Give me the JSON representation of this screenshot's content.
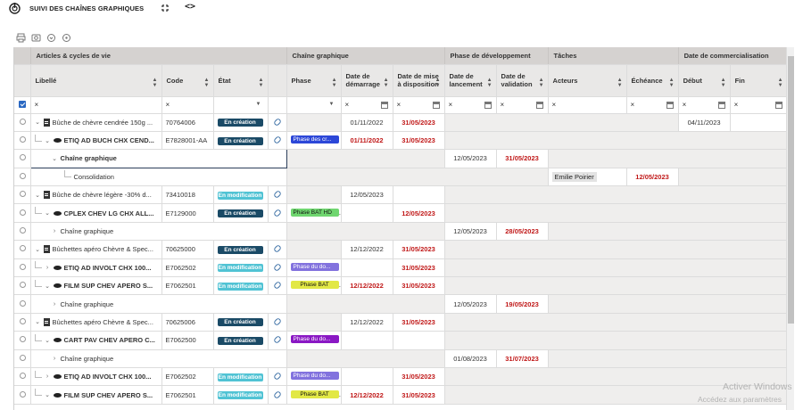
{
  "app": {
    "title": "SUIVI DES CHAÎNES GRAPHIQUES"
  },
  "groups": {
    "articles": "Articles & cycles de vie",
    "chaine": "Chaîne graphique",
    "phase_dev": "Phase de développement",
    "taches": "Tâches",
    "date_com": "Date de commercialisation"
  },
  "columns": {
    "libelle": "Libellé",
    "code": "Code",
    "etat": "État",
    "phase": "Phase",
    "demarrage": "Date de démarrage",
    "mise_dispo": "Date de mise à disposition",
    "lancement": "Date de lancement",
    "validation": "Date de validation",
    "acteurs": "Acteurs",
    "echeance": "Échéance",
    "debut": "Début",
    "fin": "Fin"
  },
  "filter_x": "×",
  "rows": [
    {
      "libelle": "Bûche de chèvre cendrée 150g ...",
      "code": "70764006",
      "etat": "En création",
      "phase": "",
      "demarrage": "01/11/2022",
      "mise": "31/05/2023",
      "debut": "04/11/2023"
    },
    {
      "libelle": "ETIQ AD BUCH CHX CEND...",
      "code": "E7828001-AA",
      "etat": "En création",
      "phase": "Phase des cr...",
      "demarrage": "01/11/2022",
      "mise": "31/05/2023"
    },
    {
      "libelle": "Chaîne graphique",
      "lancement": "12/05/2023",
      "validation": "31/05/2023"
    },
    {
      "libelle": "Consolidation",
      "acteur": "Emilie Poirier",
      "echeance": "12/05/2023"
    },
    {
      "libelle": "Bûche de chèvre légère -30% d...",
      "code": "73410018",
      "etat": "En modification",
      "demarrage": "12/05/2023"
    },
    {
      "libelle": "CPLEX CHEV LG CHX ALL...",
      "code": "E7129000",
      "etat": "En création",
      "phase": "Phase BAT HD",
      "mise": "12/05/2023"
    },
    {
      "libelle": "Chaîne graphique",
      "lancement": "12/05/2023",
      "validation": "28/05/2023"
    },
    {
      "libelle": "Bûchettes apéro Chèvre & Spec...",
      "code": "70625000",
      "etat": "En création",
      "demarrage": "12/12/2022",
      "mise": "31/05/2023"
    },
    {
      "libelle": "ETIQ AD INVOLT CHX 100...",
      "code": "E7062502",
      "etat": "En modification",
      "phase": "Phase du do...",
      "mise": "31/05/2023"
    },
    {
      "libelle": "FILM SUP CHEV APERO S...",
      "code": "E7062501",
      "etat": "En modification",
      "phase": "Phase BAT",
      "demarrage": "12/12/2022",
      "mise": "31/05/2023"
    },
    {
      "libelle": "Chaîne graphique",
      "lancement": "12/05/2023",
      "validation": "19/05/2023"
    },
    {
      "libelle": "Bûchettes apéro Chèvre & Spec...",
      "code": "70625006",
      "etat": "En création",
      "demarrage": "12/12/2022",
      "mise": "31/05/2023"
    },
    {
      "libelle": "CART PAV CHEV APERO C...",
      "code": "E7062500",
      "etat": "En création",
      "phase": "Phase du do..."
    },
    {
      "libelle": "Chaîne graphique",
      "lancement": "01/08/2023",
      "validation": "31/07/2023"
    },
    {
      "libelle": "ETIQ AD INVOLT CHX 100...",
      "code": "E7062502",
      "etat": "En modification",
      "phase": "Phase du do...",
      "mise": "31/05/2023"
    },
    {
      "libelle": "FILM SUP CHEV APERO S...",
      "code": "E7062501",
      "etat": "En modification",
      "phase": "Phase BAT",
      "demarrage": "12/12/2022",
      "mise": "31/05/2023"
    }
  ],
  "watermark": {
    "line1": "Activer Windows",
    "line2": "Accédez aux paramètres"
  },
  "colors": {
    "header_bg": "#d5d2d0",
    "badge_creation": "#1a4a66",
    "badge_modif": "#51c3d4",
    "red_date": "#c01818"
  }
}
